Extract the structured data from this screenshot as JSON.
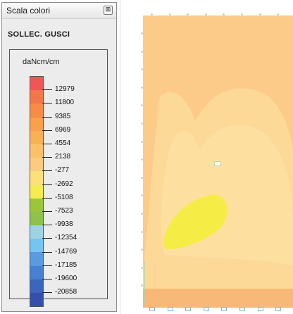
{
  "window": {
    "title": "Scala colori",
    "close_glyph": "⊠"
  },
  "panel": {
    "heading": "SOLLEC. GUSCI",
    "unit": "daNcm/cm",
    "colors": [
      "#f05656",
      "#f3764a",
      "#f68c46",
      "#f8a04a",
      "#f9b158",
      "#fbc06a",
      "#fccb80",
      "#fde07a",
      "#f4ec50",
      "#9bc63c",
      "#8ec24c",
      "#9cd4e6",
      "#76c4f2",
      "#5a9ae0",
      "#4680d0",
      "#3a66bc",
      "#3450a8"
    ],
    "levels": [
      "12979",
      "11800",
      "9385",
      "6969",
      "4554",
      "2138",
      "-277",
      "-2692",
      "-5108",
      "-7523",
      "-9938",
      "-12354",
      "-14769",
      "-17185",
      "-19600",
      "-20858"
    ]
  },
  "plot": {
    "colors": {
      "background": "#fccb8a",
      "band_mid": "#fdd998",
      "band_light": "#fde0a0",
      "peak": "#f6ec46",
      "bottom_edge": "#f8b878"
    }
  }
}
